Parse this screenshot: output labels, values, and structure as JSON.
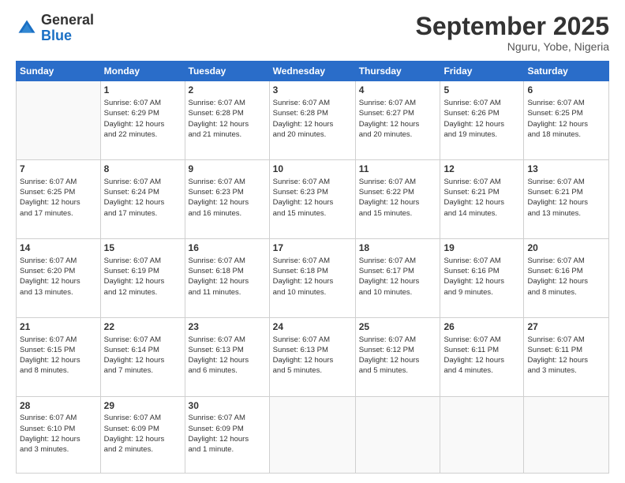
{
  "logo": {
    "general": "General",
    "blue": "Blue"
  },
  "header": {
    "month": "September 2025",
    "location": "Nguru, Yobe, Nigeria"
  },
  "weekdays": [
    "Sunday",
    "Monday",
    "Tuesday",
    "Wednesday",
    "Thursday",
    "Friday",
    "Saturday"
  ],
  "weeks": [
    [
      {
        "day": "",
        "info": ""
      },
      {
        "day": "1",
        "info": "Sunrise: 6:07 AM\nSunset: 6:29 PM\nDaylight: 12 hours\nand 22 minutes."
      },
      {
        "day": "2",
        "info": "Sunrise: 6:07 AM\nSunset: 6:28 PM\nDaylight: 12 hours\nand 21 minutes."
      },
      {
        "day": "3",
        "info": "Sunrise: 6:07 AM\nSunset: 6:28 PM\nDaylight: 12 hours\nand 20 minutes."
      },
      {
        "day": "4",
        "info": "Sunrise: 6:07 AM\nSunset: 6:27 PM\nDaylight: 12 hours\nand 20 minutes."
      },
      {
        "day": "5",
        "info": "Sunrise: 6:07 AM\nSunset: 6:26 PM\nDaylight: 12 hours\nand 19 minutes."
      },
      {
        "day": "6",
        "info": "Sunrise: 6:07 AM\nSunset: 6:25 PM\nDaylight: 12 hours\nand 18 minutes."
      }
    ],
    [
      {
        "day": "7",
        "info": "Sunrise: 6:07 AM\nSunset: 6:25 PM\nDaylight: 12 hours\nand 17 minutes."
      },
      {
        "day": "8",
        "info": "Sunrise: 6:07 AM\nSunset: 6:24 PM\nDaylight: 12 hours\nand 17 minutes."
      },
      {
        "day": "9",
        "info": "Sunrise: 6:07 AM\nSunset: 6:23 PM\nDaylight: 12 hours\nand 16 minutes."
      },
      {
        "day": "10",
        "info": "Sunrise: 6:07 AM\nSunset: 6:23 PM\nDaylight: 12 hours\nand 15 minutes."
      },
      {
        "day": "11",
        "info": "Sunrise: 6:07 AM\nSunset: 6:22 PM\nDaylight: 12 hours\nand 15 minutes."
      },
      {
        "day": "12",
        "info": "Sunrise: 6:07 AM\nSunset: 6:21 PM\nDaylight: 12 hours\nand 14 minutes."
      },
      {
        "day": "13",
        "info": "Sunrise: 6:07 AM\nSunset: 6:21 PM\nDaylight: 12 hours\nand 13 minutes."
      }
    ],
    [
      {
        "day": "14",
        "info": "Sunrise: 6:07 AM\nSunset: 6:20 PM\nDaylight: 12 hours\nand 13 minutes."
      },
      {
        "day": "15",
        "info": "Sunrise: 6:07 AM\nSunset: 6:19 PM\nDaylight: 12 hours\nand 12 minutes."
      },
      {
        "day": "16",
        "info": "Sunrise: 6:07 AM\nSunset: 6:18 PM\nDaylight: 12 hours\nand 11 minutes."
      },
      {
        "day": "17",
        "info": "Sunrise: 6:07 AM\nSunset: 6:18 PM\nDaylight: 12 hours\nand 10 minutes."
      },
      {
        "day": "18",
        "info": "Sunrise: 6:07 AM\nSunset: 6:17 PM\nDaylight: 12 hours\nand 10 minutes."
      },
      {
        "day": "19",
        "info": "Sunrise: 6:07 AM\nSunset: 6:16 PM\nDaylight: 12 hours\nand 9 minutes."
      },
      {
        "day": "20",
        "info": "Sunrise: 6:07 AM\nSunset: 6:16 PM\nDaylight: 12 hours\nand 8 minutes."
      }
    ],
    [
      {
        "day": "21",
        "info": "Sunrise: 6:07 AM\nSunset: 6:15 PM\nDaylight: 12 hours\nand 8 minutes."
      },
      {
        "day": "22",
        "info": "Sunrise: 6:07 AM\nSunset: 6:14 PM\nDaylight: 12 hours\nand 7 minutes."
      },
      {
        "day": "23",
        "info": "Sunrise: 6:07 AM\nSunset: 6:13 PM\nDaylight: 12 hours\nand 6 minutes."
      },
      {
        "day": "24",
        "info": "Sunrise: 6:07 AM\nSunset: 6:13 PM\nDaylight: 12 hours\nand 5 minutes."
      },
      {
        "day": "25",
        "info": "Sunrise: 6:07 AM\nSunset: 6:12 PM\nDaylight: 12 hours\nand 5 minutes."
      },
      {
        "day": "26",
        "info": "Sunrise: 6:07 AM\nSunset: 6:11 PM\nDaylight: 12 hours\nand 4 minutes."
      },
      {
        "day": "27",
        "info": "Sunrise: 6:07 AM\nSunset: 6:11 PM\nDaylight: 12 hours\nand 3 minutes."
      }
    ],
    [
      {
        "day": "28",
        "info": "Sunrise: 6:07 AM\nSunset: 6:10 PM\nDaylight: 12 hours\nand 3 minutes."
      },
      {
        "day": "29",
        "info": "Sunrise: 6:07 AM\nSunset: 6:09 PM\nDaylight: 12 hours\nand 2 minutes."
      },
      {
        "day": "30",
        "info": "Sunrise: 6:07 AM\nSunset: 6:09 PM\nDaylight: 12 hours\nand 1 minute."
      },
      {
        "day": "",
        "info": ""
      },
      {
        "day": "",
        "info": ""
      },
      {
        "day": "",
        "info": ""
      },
      {
        "day": "",
        "info": ""
      }
    ]
  ]
}
